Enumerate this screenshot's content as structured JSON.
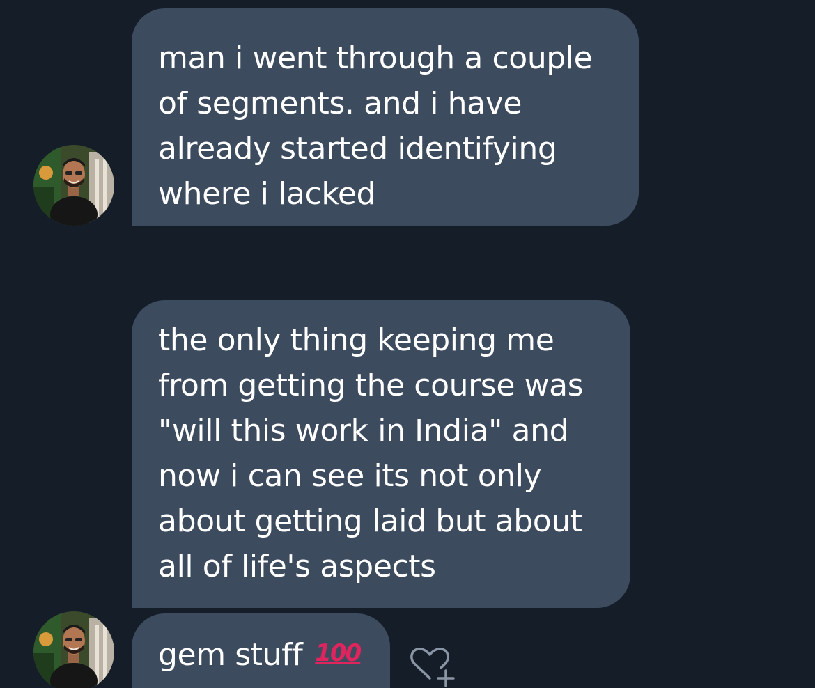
{
  "messages": [
    {
      "lines": [
        "man i went through a couple",
        "of segments. and i have",
        "already started identifying",
        "where i lacked"
      ]
    },
    {
      "lines": [
        "the only thing keeping me",
        "from getting the course was",
        "\"will this work in India\" and",
        "now i can see its not only",
        "about getting laid but about",
        "all of life's aspects"
      ]
    },
    {
      "text": "gem stuff",
      "emoji": "💯",
      "emoji_fallback": "100"
    }
  ],
  "icons": {
    "avatar": "user-avatar",
    "reaction": "heart-plus-icon"
  },
  "colors": {
    "background": "#151d29",
    "bubble": "#3d4b5f",
    "text": "#ffffff",
    "emoji": "#e0245e"
  }
}
